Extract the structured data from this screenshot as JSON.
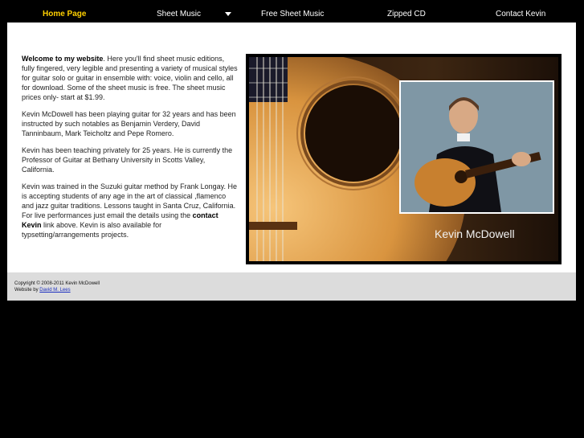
{
  "nav": {
    "home": "Home Page",
    "sheet_music": "Sheet Music",
    "free_sheet_music": "Free Sheet Music",
    "zipped_cd": "Zipped CD",
    "contact": "Contact Kevin",
    "active_color": "#ffd000"
  },
  "intro": {
    "p1_lead": "Welcome to my website",
    "p1_rest": ". Here you'll find sheet music editions, fully fingered, very legible and presenting a variety of musical styles for guitar solo or guitar in ensemble with: voice, violin and cello, all for download. Some of the sheet music is free. The sheet music prices only- start at $1.99.",
    "p2": "Kevin McDowell has been playing guitar for 32 years and has been instructed by such notables as Benjamin Verdery, David Tanninbaum, Mark Teicholtz and Pepe Romero.",
    "p3": "Kevin has been teaching privately for 25 years. He is currently the Professor of Guitar at Bethany University in Scotts Valley, California.",
    "p4_before": "Kevin was trained in the Suzuki guitar method by Frank Longay. He is accepting students of any age in the art of classical ,flamenco and jazz guitar traditions. Lessons taught in Santa Cruz, California. For live performances just email the details using the ",
    "p4_link": "contact Kevin",
    "p4_after": " link above. Kevin is also available for typsetting/arrangements projects."
  },
  "hero": {
    "caption": "Kevin McDowell"
  },
  "footer": {
    "copyright": "Copyright © 2008-2011 Kevin McDowell",
    "credit_prefix": "Website by ",
    "credit_link": "David M. Lees"
  }
}
